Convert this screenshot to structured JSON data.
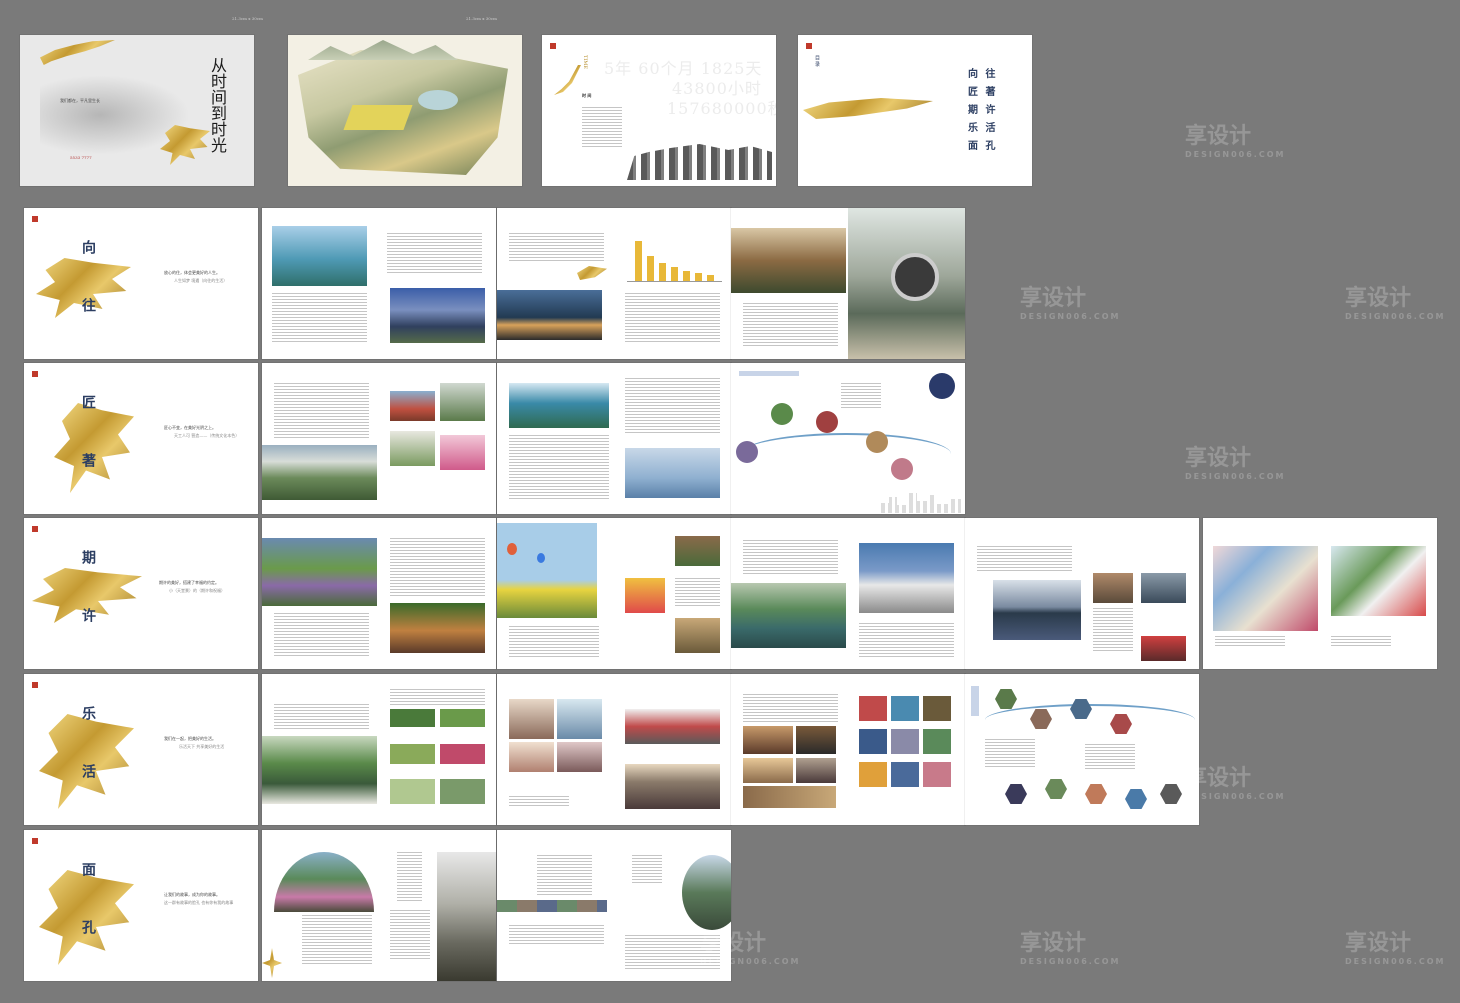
{
  "spread_labels": [
    "21.3cm x 30cm",
    "21.3cm x 30cm"
  ],
  "cover": {
    "title_chars": "从时间到时光",
    "tagline": "我们都在，平凡里生长",
    "phone": "5533 7777"
  },
  "time_page": {
    "label": "TIME",
    "heading": "时  间",
    "numbers": [
      "5年 60个月 1825天",
      "43800小时",
      "157680000秒"
    ]
  },
  "toc": {
    "title": "目 录",
    "items": [
      "向 往",
      "匠 著",
      "期 许",
      "乐 活",
      "面 孔"
    ]
  },
  "chapters": [
    {
      "name": "向往",
      "char1": "向",
      "char2": "往",
      "line1": "放心的住，体会更美好的人生。",
      "line2": "人生如梦 境遇（向往的生活）"
    },
    {
      "name": "匠著",
      "char1": "匠",
      "char2": "著",
      "line1": "匠心不变，在美好光阴之上。",
      "line2": "天工人可 营造——（传统文化本色）"
    },
    {
      "name": "期许",
      "char1": "期",
      "char2": "许",
      "line1": "期许的美好，搭建了幸福的约定。",
      "line2": "小（天堂景）的（期许和祝福）"
    },
    {
      "name": "乐活",
      "char1": "乐",
      "char2": "活",
      "line1": "我们在一起，把美好的生活。",
      "line2": "乐活天下 共享美好的生活"
    },
    {
      "name": "面孔",
      "char1": "面",
      "char2": "孔",
      "line1": "让我们的故事，成为你的故事。",
      "line2": "这一群有故事的脸孔 也有你有我的故事"
    }
  ],
  "watermark": {
    "cn": "享设计",
    "en": "DESIGN006.COM"
  },
  "colors": {
    "background": "#7a7a7a",
    "page": "#ffffff",
    "gold": "#c49a32",
    "navy": "#2c3e62",
    "accent_red": "#c0392b"
  }
}
